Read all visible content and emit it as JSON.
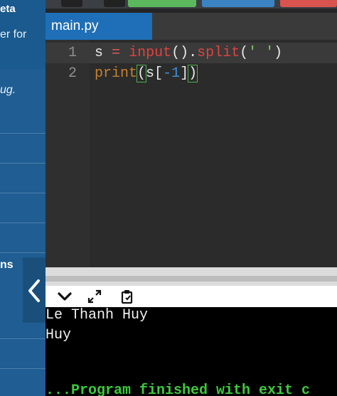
{
  "sidebar": {
    "top_label": "eta",
    "line_for": "er for",
    "line_bug": "ug.",
    "section_label": "ns",
    "collapse_icon": "chevron-left-icon"
  },
  "toolbar": {
    "run_label": "",
    "debug_label": "",
    "stdin_label": ""
  },
  "tab": {
    "filename": "main.py"
  },
  "editor": {
    "line_numbers": [
      "1",
      "2"
    ],
    "lines": [
      "s = input().split(' ')",
      "print(s[-1])"
    ]
  },
  "console_toolbar": {
    "icons": [
      "chevron-down-icon",
      "expand-icon",
      "copy-icon"
    ]
  },
  "console": {
    "output_lines": [
      "Le Thanh Huy",
      "Huy"
    ],
    "status": "...Program finished with exit c"
  },
  "colors": {
    "sidebar": "#1f5d92",
    "tab_active": "#1e6fb7",
    "editor_bg": "#2b2b2b",
    "console_bg": "#000000",
    "run_button": "#5cb85c",
    "debug_button": "#3b84c4",
    "stdin_button": "#d9534f"
  }
}
